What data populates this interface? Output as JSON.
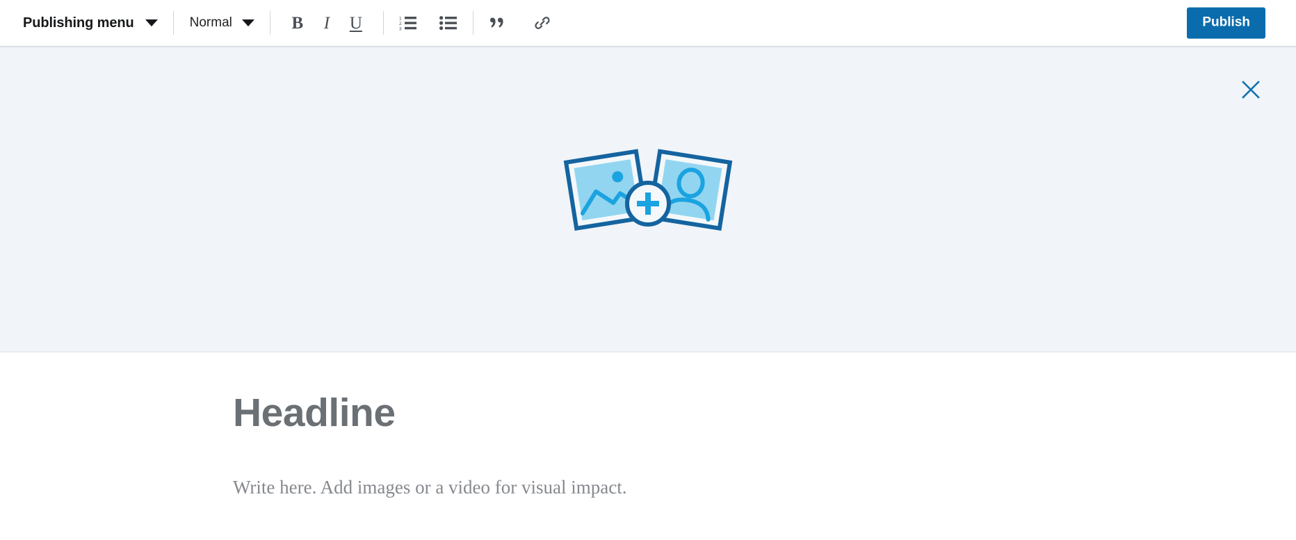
{
  "toolbar": {
    "publishing_menu": {
      "label": "Publishing menu",
      "caret_icon": "chevron-down-icon"
    },
    "style_select": {
      "label": "Normal",
      "caret_icon": "chevron-down-icon",
      "options": [
        "Normal"
      ]
    },
    "format_buttons": [
      {
        "name": "bold-button",
        "glyph": "B",
        "icon": "bold-icon"
      },
      {
        "name": "italic-button",
        "glyph": "I",
        "icon": "italic-icon"
      },
      {
        "name": "underline-button",
        "glyph": "U",
        "icon": "underline-icon"
      }
    ],
    "list_buttons": [
      {
        "name": "ordered-list-button",
        "icon": "ordered-list-icon"
      },
      {
        "name": "unordered-list-button",
        "icon": "unordered-list-icon"
      }
    ],
    "insert_buttons": [
      {
        "name": "blockquote-button",
        "icon": "quote-icon"
      },
      {
        "name": "link-button",
        "icon": "link-icon"
      }
    ],
    "publish_label": "Publish"
  },
  "media_panel": {
    "close_icon": "close-icon",
    "illustration_icon": "add-photos-icon",
    "plus_icon": "plus-icon"
  },
  "article": {
    "headline_placeholder": "Headline",
    "body_placeholder": "Write here. Add images or a video for visual impact."
  },
  "colors": {
    "accent_blue": "#0a6cad",
    "icon_blue": "#1aa3e0",
    "frame_blue": "#1464a0",
    "photo_fill": "#92d5f0",
    "panel_background": "#f1f4f8",
    "toolbar_icon": "#4a4f55",
    "placeholder_gray": "#6b7075"
  }
}
